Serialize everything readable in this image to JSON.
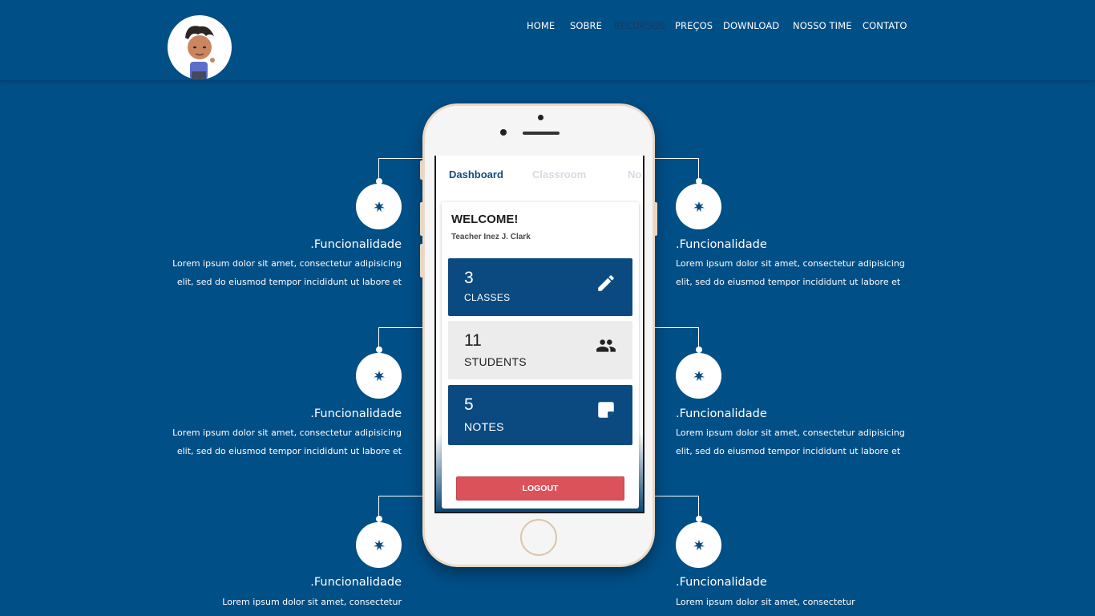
{
  "nav": {
    "items": [
      {
        "label": "HOME"
      },
      {
        "label": "SOBRE"
      },
      {
        "label": "RECURSOS"
      },
      {
        "label": "PREÇOS"
      },
      {
        "label": "DOWNLOAD"
      },
      {
        "label": "NOSSO TIME"
      },
      {
        "label": "CONTATO"
      }
    ],
    "active_item": "RECURSOS"
  },
  "logo": {
    "icon": "cartoon-kid-avatar"
  },
  "features": {
    "left": [
      {
        "title": ".Funcionalidade",
        "text": "Lorem ipsum dolor sit amet, consectetur adipisicing elit, sed do eiusmod tempor incididunt ut labore et",
        "icon": "star-icon"
      },
      {
        "title": ".Funcionalidade",
        "text": "Lorem ipsum dolor sit amet, consectetur adipisicing elit, sed do eiusmod tempor incididunt ut labore et",
        "icon": "star-icon"
      },
      {
        "title": ".Funcionalidade",
        "text": "Lorem ipsum dolor sit amet, consectetur",
        "icon": "star-icon"
      }
    ],
    "right": [
      {
        "title": ".Funcionalidade",
        "text": "Lorem ipsum dolor sit amet, consectetur adipisicing elit, sed do eiusmod tempor incididunt ut labore et",
        "icon": "star-icon"
      },
      {
        "title": ".Funcionalidade",
        "text": "Lorem ipsum dolor sit amet, consectetur adipisicing elit, sed do eiusmod tempor incididunt ut labore et",
        "icon": "star-icon"
      },
      {
        "title": ".Funcionalidade",
        "text": "Lorem ipsum dolor sit amet, consectetur",
        "icon": "star-icon"
      }
    ]
  },
  "phone": {
    "tabs": [
      {
        "label": "Dashboard"
      },
      {
        "label": "Classroom"
      },
      {
        "label": "No"
      }
    ],
    "welcome": "WELCOME!",
    "teacher": "Teacher Inez J. Clark",
    "stats": [
      {
        "value": "3",
        "label": "CLASSES",
        "icon": "pencil-icon"
      },
      {
        "value": "11",
        "label": "STUDENTS",
        "icon": "people-icon"
      },
      {
        "value": "5",
        "label": "NOTES",
        "icon": "note-icon"
      }
    ],
    "logout_label": "LOGOUT"
  },
  "colors": {
    "background": "#004f87",
    "stat_blue": "#0b4a80",
    "logout_red": "#dc525b",
    "star": "#0b4a80"
  }
}
